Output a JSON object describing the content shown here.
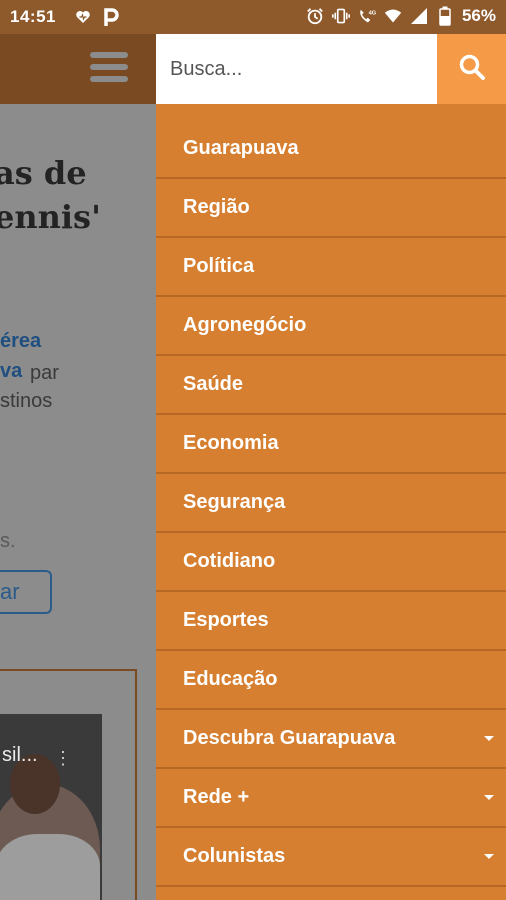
{
  "status_bar": {
    "time": "14:51",
    "battery_percent": "56%",
    "network_label": "4G",
    "left_icons": [
      "heart-icon",
      "parking-p-icon"
    ],
    "right_icons": [
      "alarm-icon",
      "vibrate-icon",
      "call-4g-icon",
      "wifi-icon",
      "signal-icon",
      "battery-icon"
    ]
  },
  "background_page": {
    "headline_line1": "as de",
    "headline_line2": "ennis'",
    "link_line1": "érea",
    "link_line2": "va",
    "text_line2_rest": "par",
    "text_line3": "stinos",
    "text_fragment": "s.",
    "button_fragment": "ar",
    "video_caption": "sil...",
    "video_menu": "⋮"
  },
  "drawer": {
    "search": {
      "placeholder": "Busca...",
      "value": ""
    },
    "menu_items": [
      {
        "label": "Guarapuava",
        "has_submenu": false
      },
      {
        "label": "Região",
        "has_submenu": false
      },
      {
        "label": "Política",
        "has_submenu": false
      },
      {
        "label": "Agronegócio",
        "has_submenu": false
      },
      {
        "label": "Saúde",
        "has_submenu": false
      },
      {
        "label": "Economia",
        "has_submenu": false
      },
      {
        "label": "Segurança",
        "has_submenu": false
      },
      {
        "label": "Cotidiano",
        "has_submenu": false
      },
      {
        "label": "Esportes",
        "has_submenu": false
      },
      {
        "label": "Educação",
        "has_submenu": false
      },
      {
        "label": "Descubra Guarapuava",
        "has_submenu": true
      },
      {
        "label": "Rede +",
        "has_submenu": true
      },
      {
        "label": "Colunistas",
        "has_submenu": true
      }
    ]
  },
  "colors": {
    "drawer_bg": "#d67f30",
    "search_button_bg": "#f59a47",
    "status_bar_bg": "#8e5a2c",
    "link_blue": "#1f4f80"
  }
}
